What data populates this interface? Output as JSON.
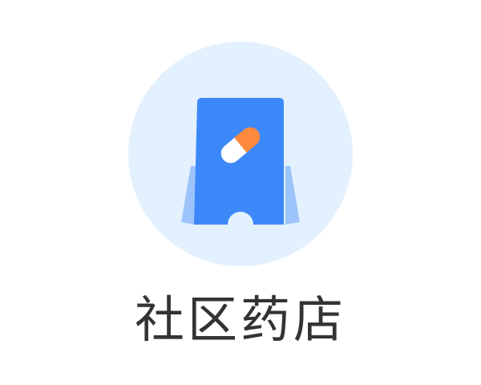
{
  "app": {
    "label": "社区药店",
    "icon": "pharmacy-store-icon"
  },
  "colors": {
    "circle_bg": "#E3F1FE",
    "store_blue": "#3D88F9",
    "store_side": "#9CC4FB",
    "pill_orange": "#FF8A3D",
    "pill_white": "#FFFFFF",
    "label_text": "#333333"
  }
}
